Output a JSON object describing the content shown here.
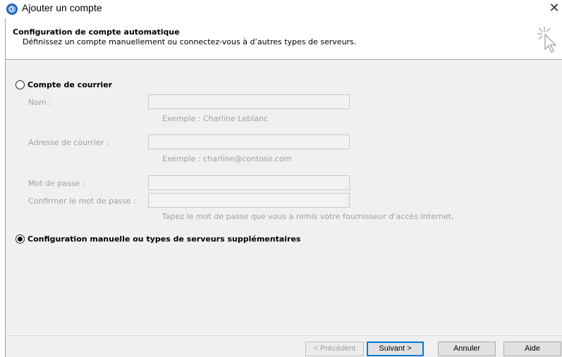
{
  "window": {
    "title": "Ajouter un compte",
    "close_glyph": "✕",
    "icon": "outlook-app-icon"
  },
  "header": {
    "title": "Configuration de compte automatique",
    "subtitle": "Définissez un compte manuellement ou connectez-vous à d’autres types de serveurs.",
    "icon": "wizard-cursor-icon"
  },
  "options": {
    "email_account": {
      "label": "Compte de courrier",
      "selected": false
    },
    "manual_config": {
      "label": "Configuration manuelle ou types de serveurs supplémentaires",
      "selected": true
    }
  },
  "form": {
    "name_label": "Nom :",
    "name_value": "",
    "name_hint": "Exemple : Charline Leblanc",
    "email_label": "Adresse de courrier :",
    "email_value": "",
    "email_hint": "Exemple : charline@contoso.com",
    "password_label": "Mot de passe :",
    "password_value": "",
    "confirm_label": "Confirmer le mot de passe :",
    "confirm_value": "",
    "password_hint": "Tapez le mot de passe que vous a remis votre fournisseur d’accès Internet."
  },
  "buttons": {
    "back": "< Précédent",
    "next": "Suivant >",
    "cancel": "Annuler",
    "help": "Aide"
  },
  "colors": {
    "body_background": "#f0f0f0",
    "disabled_text": "#a0a0a0",
    "focus_border": "#0078d7"
  }
}
